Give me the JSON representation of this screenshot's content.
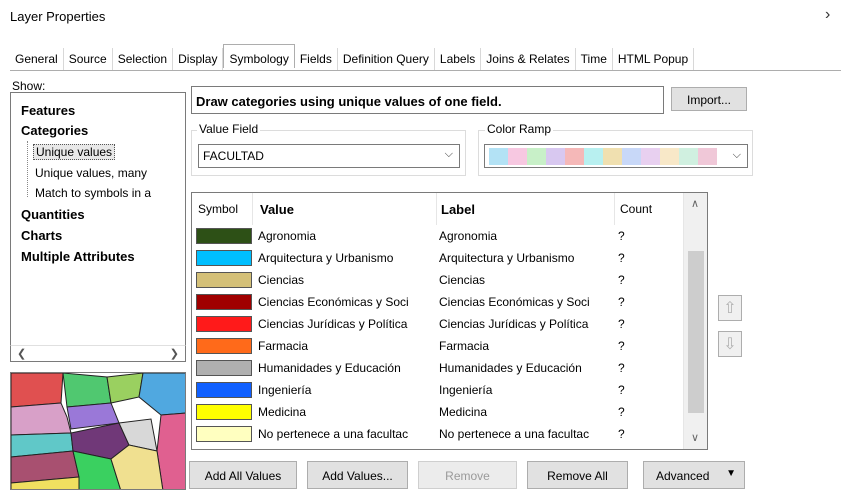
{
  "window": {
    "title": "Layer Properties",
    "close_glyph": "›"
  },
  "tabs": [
    {
      "label": "General"
    },
    {
      "label": "Source"
    },
    {
      "label": "Selection"
    },
    {
      "label": "Display"
    },
    {
      "label": "Symbology",
      "active": true
    },
    {
      "label": "Fields"
    },
    {
      "label": "Definition Query"
    },
    {
      "label": "Labels"
    },
    {
      "label": "Joins & Relates"
    },
    {
      "label": "Time"
    },
    {
      "label": "HTML Popup"
    }
  ],
  "show": {
    "label": "Show:",
    "tree": {
      "features": "Features",
      "categories": "Categories",
      "unique_values": "Unique values",
      "unique_values_many": "Unique values, many",
      "match_symbols": "Match to symbols in a",
      "quantities": "Quantities",
      "charts": "Charts",
      "multiple_attributes": "Multiple Attributes"
    }
  },
  "headline": "Draw categories using unique values of one field.",
  "import_button": "Import...",
  "value_field": {
    "label": "Value Field",
    "value": "FACULTAD"
  },
  "color_ramp": {
    "label": "Color Ramp",
    "colors": [
      "#b3e2f5",
      "#f7c8e1",
      "#c8f0c8",
      "#d8c8f0",
      "#f5b8b8",
      "#b8f0f0",
      "#f0e0b0",
      "#c8d8f8",
      "#e8d0f0",
      "#f8e8c8",
      "#d0f0e0",
      "#f0c8d8"
    ]
  },
  "table": {
    "headers": {
      "symbol": "Symbol",
      "value": "Value",
      "label": "Label",
      "count": "Count"
    },
    "rows": [
      {
        "color": "#2d5016",
        "value": "Agronomia",
        "label": "Agronomia",
        "count": "?"
      },
      {
        "color": "#00bfff",
        "value": "Arquitectura y Urbanismo",
        "label": "Arquitectura y Urbanismo",
        "count": "?"
      },
      {
        "color": "#d4c078",
        "value": "Ciencias",
        "label": "Ciencias",
        "count": "?"
      },
      {
        "color": "#a00000",
        "value": "Ciencias Económicas y Soci",
        "label": "Ciencias Económicas y Soci",
        "count": "?"
      },
      {
        "color": "#ff1a1a",
        "value": "Ciencias Jurídicas y Política",
        "label": "Ciencias Jurídicas y Política",
        "count": "?"
      },
      {
        "color": "#ff6a1a",
        "value": "Farmacia",
        "label": "Farmacia",
        "count": "?"
      },
      {
        "color": "#b0b0b0",
        "value": "Humanidades y Educación",
        "label": "Humanidades y Educación",
        "count": "?"
      },
      {
        "color": "#1060ff",
        "value": "Ingeniería",
        "label": "Ingeniería",
        "count": "?"
      },
      {
        "color": "#ffff00",
        "value": "Medicina",
        "label": "Medicina",
        "count": "?"
      },
      {
        "color": "#ffffc0",
        "value": "No pertenece a una facultac",
        "label": "No pertenece a una facultac",
        "count": "?"
      }
    ]
  },
  "buttons": {
    "add_all_values": "Add All Values",
    "add_values": "Add Values...",
    "remove": "Remove",
    "remove_all": "Remove All",
    "advanced": "Advanced"
  }
}
